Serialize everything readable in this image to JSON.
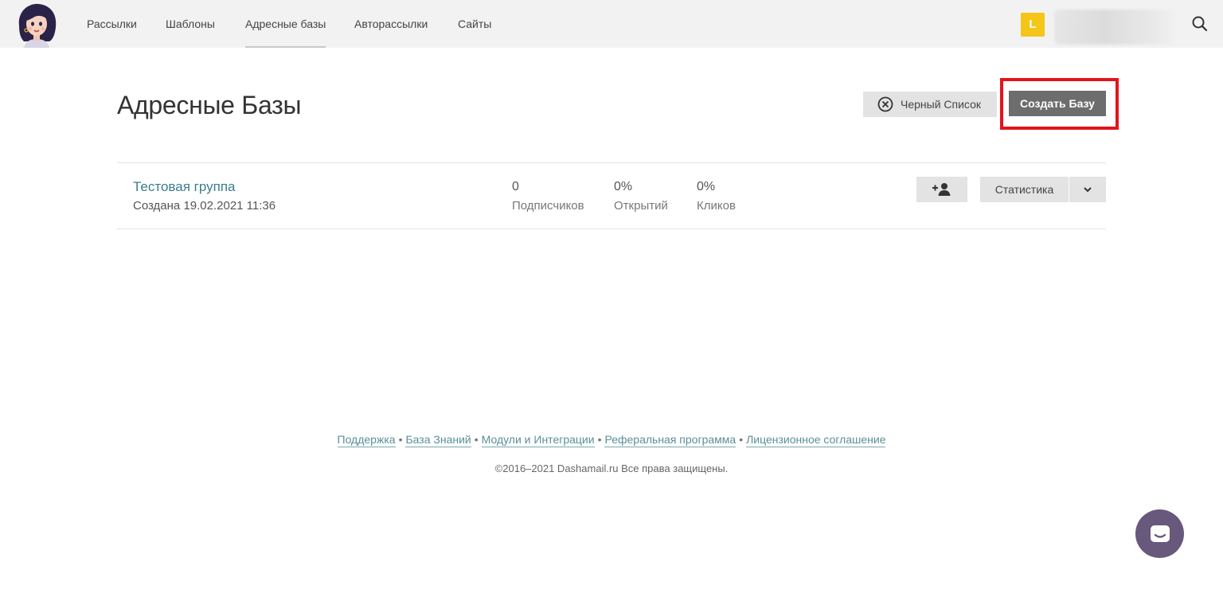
{
  "nav": {
    "items": [
      {
        "label": "Рассылки"
      },
      {
        "label": "Шаблоны"
      },
      {
        "label": "Адресные базы"
      },
      {
        "label": "Авторассылки"
      },
      {
        "label": "Сайты"
      }
    ],
    "active_index": 2,
    "user_badge": "L"
  },
  "header": {
    "title": "Адресные Базы",
    "blacklist_label": "Черный Список",
    "create_label": "Создать Базу"
  },
  "groups": [
    {
      "name": "Тестовая группа",
      "created": "Создана 19.02.2021 11:36",
      "subscribers_value": "0",
      "subscribers_label": "Подписчиков",
      "opens_value": "0%",
      "opens_label": "Открытий",
      "clicks_value": "0%",
      "clicks_label": "Кликов",
      "stats_label": "Статистика"
    }
  ],
  "footer": {
    "links": [
      "Поддержка",
      "База Знаний",
      "Модули и Интеграции",
      "Реферальная программа",
      "Лицензионное соглашение"
    ],
    "separator": "•",
    "copyright": "©2016–2021 Dashamail.ru Все права защищены."
  },
  "colors": {
    "accent_link": "#3a7e8c",
    "highlight_frame": "#e3141b",
    "primary_button": "#6d6d6d",
    "user_badge": "#f5c518",
    "chat_widget": "#67587c"
  },
  "icons": {
    "logo": "dasha-avatar-icon",
    "search": "search-icon",
    "blacklist": "circle-x-icon",
    "add_subscriber": "add-user-icon",
    "dropdown": "chevron-down-icon",
    "chat": "chat-icon"
  }
}
